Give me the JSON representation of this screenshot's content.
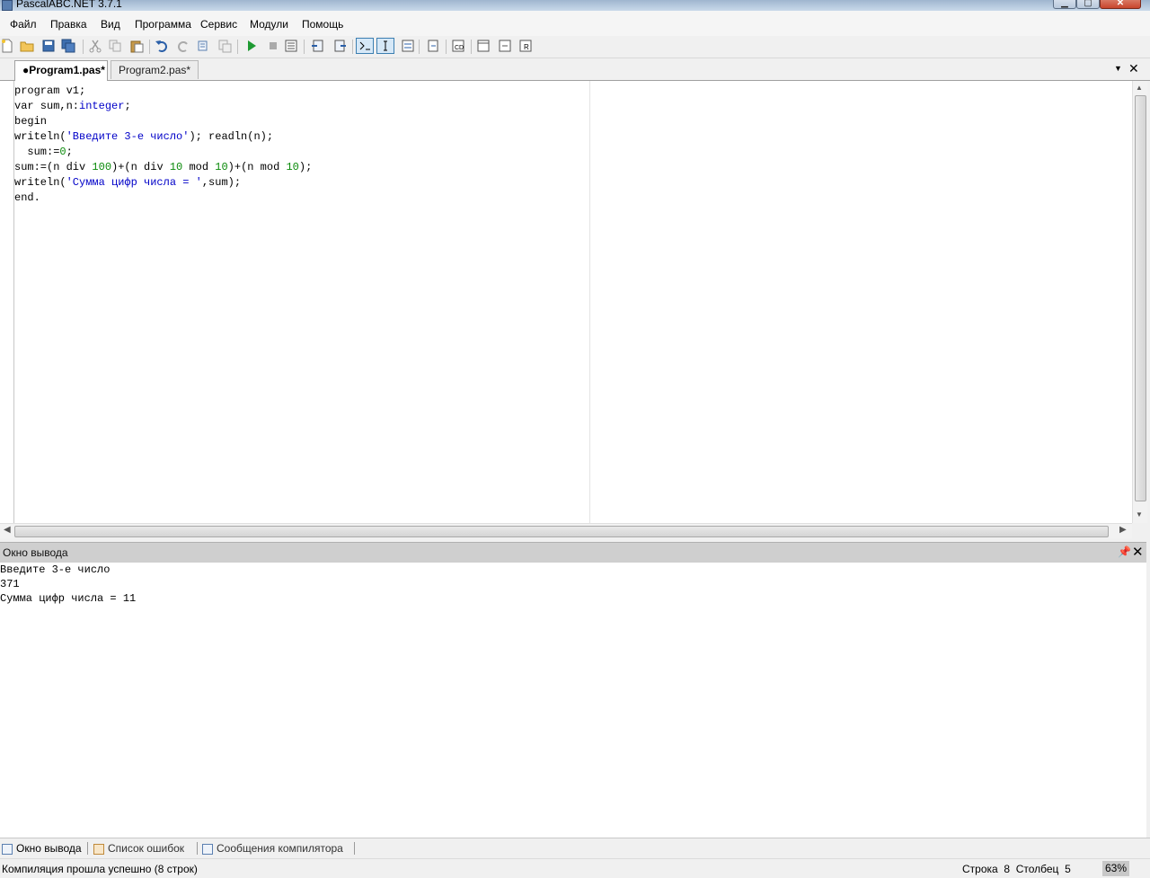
{
  "window": {
    "title": "PascalABC.NET 3.7.1"
  },
  "menu": [
    "Файл",
    "Правка",
    "Вид",
    "Программа",
    "Сервис",
    "Модули",
    "Помощь"
  ],
  "tabs": [
    {
      "label": "●Program1.pas*",
      "active": true
    },
    {
      "label": "Program2.pas*",
      "active": false
    }
  ],
  "editor": {
    "lines": [
      [
        {
          "t": "program v1;",
          "c": "kw"
        }
      ],
      [
        {
          "t": "var sum,n:",
          "c": "kw"
        },
        {
          "t": "integer",
          "c": "typ"
        },
        {
          "t": ";",
          "c": "kw"
        }
      ],
      [
        {
          "t": "begin",
          "c": "kw"
        }
      ],
      [
        {
          "t": "writeln(",
          "c": "kw"
        },
        {
          "t": "'Введите 3-е число'",
          "c": "str"
        },
        {
          "t": "); readln(n);",
          "c": "kw"
        }
      ],
      [
        {
          "t": "  sum:=",
          "c": "kw"
        },
        {
          "t": "0",
          "c": "num"
        },
        {
          "t": ";",
          "c": "kw"
        }
      ],
      [
        {
          "t": "sum:=(n div ",
          "c": "kw"
        },
        {
          "t": "100",
          "c": "num"
        },
        {
          "t": ")+(n div ",
          "c": "kw"
        },
        {
          "t": "10",
          "c": "num"
        },
        {
          "t": " mod ",
          "c": "kw"
        },
        {
          "t": "10",
          "c": "num"
        },
        {
          "t": ")+(n mod ",
          "c": "kw"
        },
        {
          "t": "10",
          "c": "num"
        },
        {
          "t": ");",
          "c": "kw"
        }
      ],
      [
        {
          "t": "writeln(",
          "c": "kw"
        },
        {
          "t": "'Сумма цифр числа = '",
          "c": "str"
        },
        {
          "t": ",sum);",
          "c": "kw"
        }
      ],
      [
        {
          "t": "end.",
          "c": "kw"
        }
      ]
    ]
  },
  "output_panel": {
    "title": "Окно вывода",
    "lines": [
      "Введите 3-е число",
      "371",
      "Сумма цифр числа = 11"
    ]
  },
  "bottom_tabs": [
    "Окно вывода",
    "Список ошибок",
    "Сообщения компилятора"
  ],
  "status": {
    "message": "Компиляция прошла успешно (8 строк)",
    "position": "Строка  8  Столбец  5",
    "zoom": "63%"
  },
  "colors": {
    "string": "#0000c8",
    "number": "#0a8a0a",
    "type": "#0000c8"
  }
}
